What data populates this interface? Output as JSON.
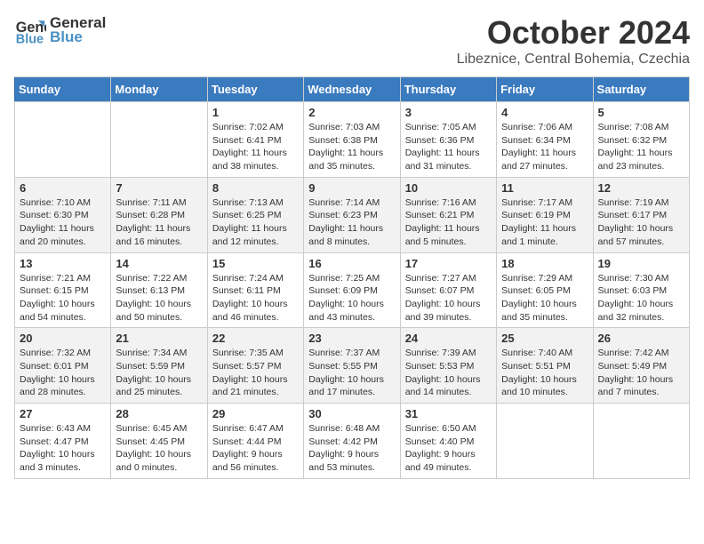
{
  "header": {
    "logo_line1": "General",
    "logo_line2": "Blue",
    "month_title": "October 2024",
    "location": "Libeznice, Central Bohemia, Czechia"
  },
  "days_of_week": [
    "Sunday",
    "Monday",
    "Tuesday",
    "Wednesday",
    "Thursday",
    "Friday",
    "Saturday"
  ],
  "weeks": [
    [
      {
        "day": "",
        "info": ""
      },
      {
        "day": "",
        "info": ""
      },
      {
        "day": "1",
        "info": "Sunrise: 7:02 AM\nSunset: 6:41 PM\nDaylight: 11 hours\nand 38 minutes."
      },
      {
        "day": "2",
        "info": "Sunrise: 7:03 AM\nSunset: 6:38 PM\nDaylight: 11 hours\nand 35 minutes."
      },
      {
        "day": "3",
        "info": "Sunrise: 7:05 AM\nSunset: 6:36 PM\nDaylight: 11 hours\nand 31 minutes."
      },
      {
        "day": "4",
        "info": "Sunrise: 7:06 AM\nSunset: 6:34 PM\nDaylight: 11 hours\nand 27 minutes."
      },
      {
        "day": "5",
        "info": "Sunrise: 7:08 AM\nSunset: 6:32 PM\nDaylight: 11 hours\nand 23 minutes."
      }
    ],
    [
      {
        "day": "6",
        "info": "Sunrise: 7:10 AM\nSunset: 6:30 PM\nDaylight: 11 hours\nand 20 minutes."
      },
      {
        "day": "7",
        "info": "Sunrise: 7:11 AM\nSunset: 6:28 PM\nDaylight: 11 hours\nand 16 minutes."
      },
      {
        "day": "8",
        "info": "Sunrise: 7:13 AM\nSunset: 6:25 PM\nDaylight: 11 hours\nand 12 minutes."
      },
      {
        "day": "9",
        "info": "Sunrise: 7:14 AM\nSunset: 6:23 PM\nDaylight: 11 hours\nand 8 minutes."
      },
      {
        "day": "10",
        "info": "Sunrise: 7:16 AM\nSunset: 6:21 PM\nDaylight: 11 hours\nand 5 minutes."
      },
      {
        "day": "11",
        "info": "Sunrise: 7:17 AM\nSunset: 6:19 PM\nDaylight: 11 hours\nand 1 minute."
      },
      {
        "day": "12",
        "info": "Sunrise: 7:19 AM\nSunset: 6:17 PM\nDaylight: 10 hours\nand 57 minutes."
      }
    ],
    [
      {
        "day": "13",
        "info": "Sunrise: 7:21 AM\nSunset: 6:15 PM\nDaylight: 10 hours\nand 54 minutes."
      },
      {
        "day": "14",
        "info": "Sunrise: 7:22 AM\nSunset: 6:13 PM\nDaylight: 10 hours\nand 50 minutes."
      },
      {
        "day": "15",
        "info": "Sunrise: 7:24 AM\nSunset: 6:11 PM\nDaylight: 10 hours\nand 46 minutes."
      },
      {
        "day": "16",
        "info": "Sunrise: 7:25 AM\nSunset: 6:09 PM\nDaylight: 10 hours\nand 43 minutes."
      },
      {
        "day": "17",
        "info": "Sunrise: 7:27 AM\nSunset: 6:07 PM\nDaylight: 10 hours\nand 39 minutes."
      },
      {
        "day": "18",
        "info": "Sunrise: 7:29 AM\nSunset: 6:05 PM\nDaylight: 10 hours\nand 35 minutes."
      },
      {
        "day": "19",
        "info": "Sunrise: 7:30 AM\nSunset: 6:03 PM\nDaylight: 10 hours\nand 32 minutes."
      }
    ],
    [
      {
        "day": "20",
        "info": "Sunrise: 7:32 AM\nSunset: 6:01 PM\nDaylight: 10 hours\nand 28 minutes."
      },
      {
        "day": "21",
        "info": "Sunrise: 7:34 AM\nSunset: 5:59 PM\nDaylight: 10 hours\nand 25 minutes."
      },
      {
        "day": "22",
        "info": "Sunrise: 7:35 AM\nSunset: 5:57 PM\nDaylight: 10 hours\nand 21 minutes."
      },
      {
        "day": "23",
        "info": "Sunrise: 7:37 AM\nSunset: 5:55 PM\nDaylight: 10 hours\nand 17 minutes."
      },
      {
        "day": "24",
        "info": "Sunrise: 7:39 AM\nSunset: 5:53 PM\nDaylight: 10 hours\nand 14 minutes."
      },
      {
        "day": "25",
        "info": "Sunrise: 7:40 AM\nSunset: 5:51 PM\nDaylight: 10 hours\nand 10 minutes."
      },
      {
        "day": "26",
        "info": "Sunrise: 7:42 AM\nSunset: 5:49 PM\nDaylight: 10 hours\nand 7 minutes."
      }
    ],
    [
      {
        "day": "27",
        "info": "Sunrise: 6:43 AM\nSunset: 4:47 PM\nDaylight: 10 hours\nand 3 minutes."
      },
      {
        "day": "28",
        "info": "Sunrise: 6:45 AM\nSunset: 4:45 PM\nDaylight: 10 hours\nand 0 minutes."
      },
      {
        "day": "29",
        "info": "Sunrise: 6:47 AM\nSunset: 4:44 PM\nDaylight: 9 hours\nand 56 minutes."
      },
      {
        "day": "30",
        "info": "Sunrise: 6:48 AM\nSunset: 4:42 PM\nDaylight: 9 hours\nand 53 minutes."
      },
      {
        "day": "31",
        "info": "Sunrise: 6:50 AM\nSunset: 4:40 PM\nDaylight: 9 hours\nand 49 minutes."
      },
      {
        "day": "",
        "info": ""
      },
      {
        "day": "",
        "info": ""
      }
    ]
  ]
}
